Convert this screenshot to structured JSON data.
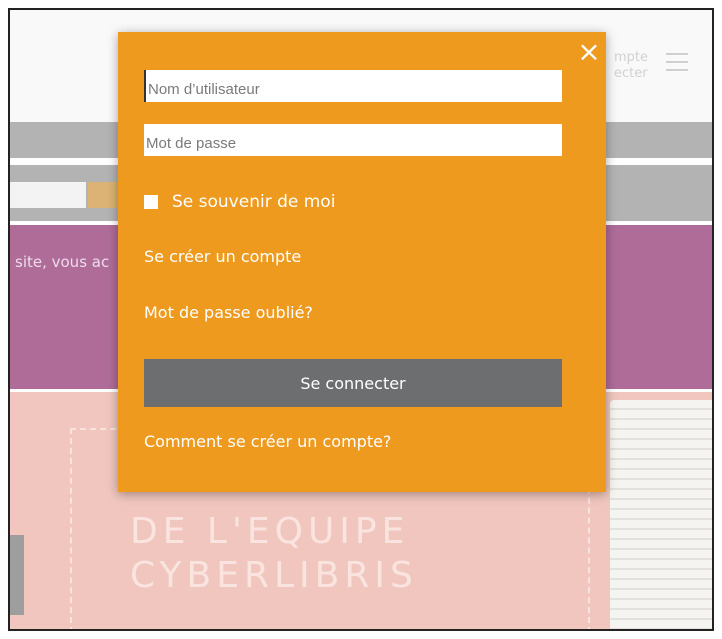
{
  "background": {
    "account_lines": [
      "mpte",
      "ecter"
    ],
    "notice_text": "site, vous ac",
    "hero_title_lines": [
      "DE L'EQUIPE",
      "CYBERLIBRIS"
    ]
  },
  "login": {
    "close_symbol": "×",
    "username_placeholder": "Nom d’utilisateur",
    "password_placeholder": "Mot de passe",
    "remember_label": "Se souvenir de moi",
    "create_account_link": "Se créer un compte",
    "forgot_password_link": "Mot de passe oublié?",
    "submit_label": "Se connecter",
    "how_to_link": "Comment se créer un compte?"
  },
  "colors": {
    "popup": "#ee9a1e",
    "button": "#6d6e70",
    "notice": "#851e63",
    "hero": "#e8a89b"
  }
}
